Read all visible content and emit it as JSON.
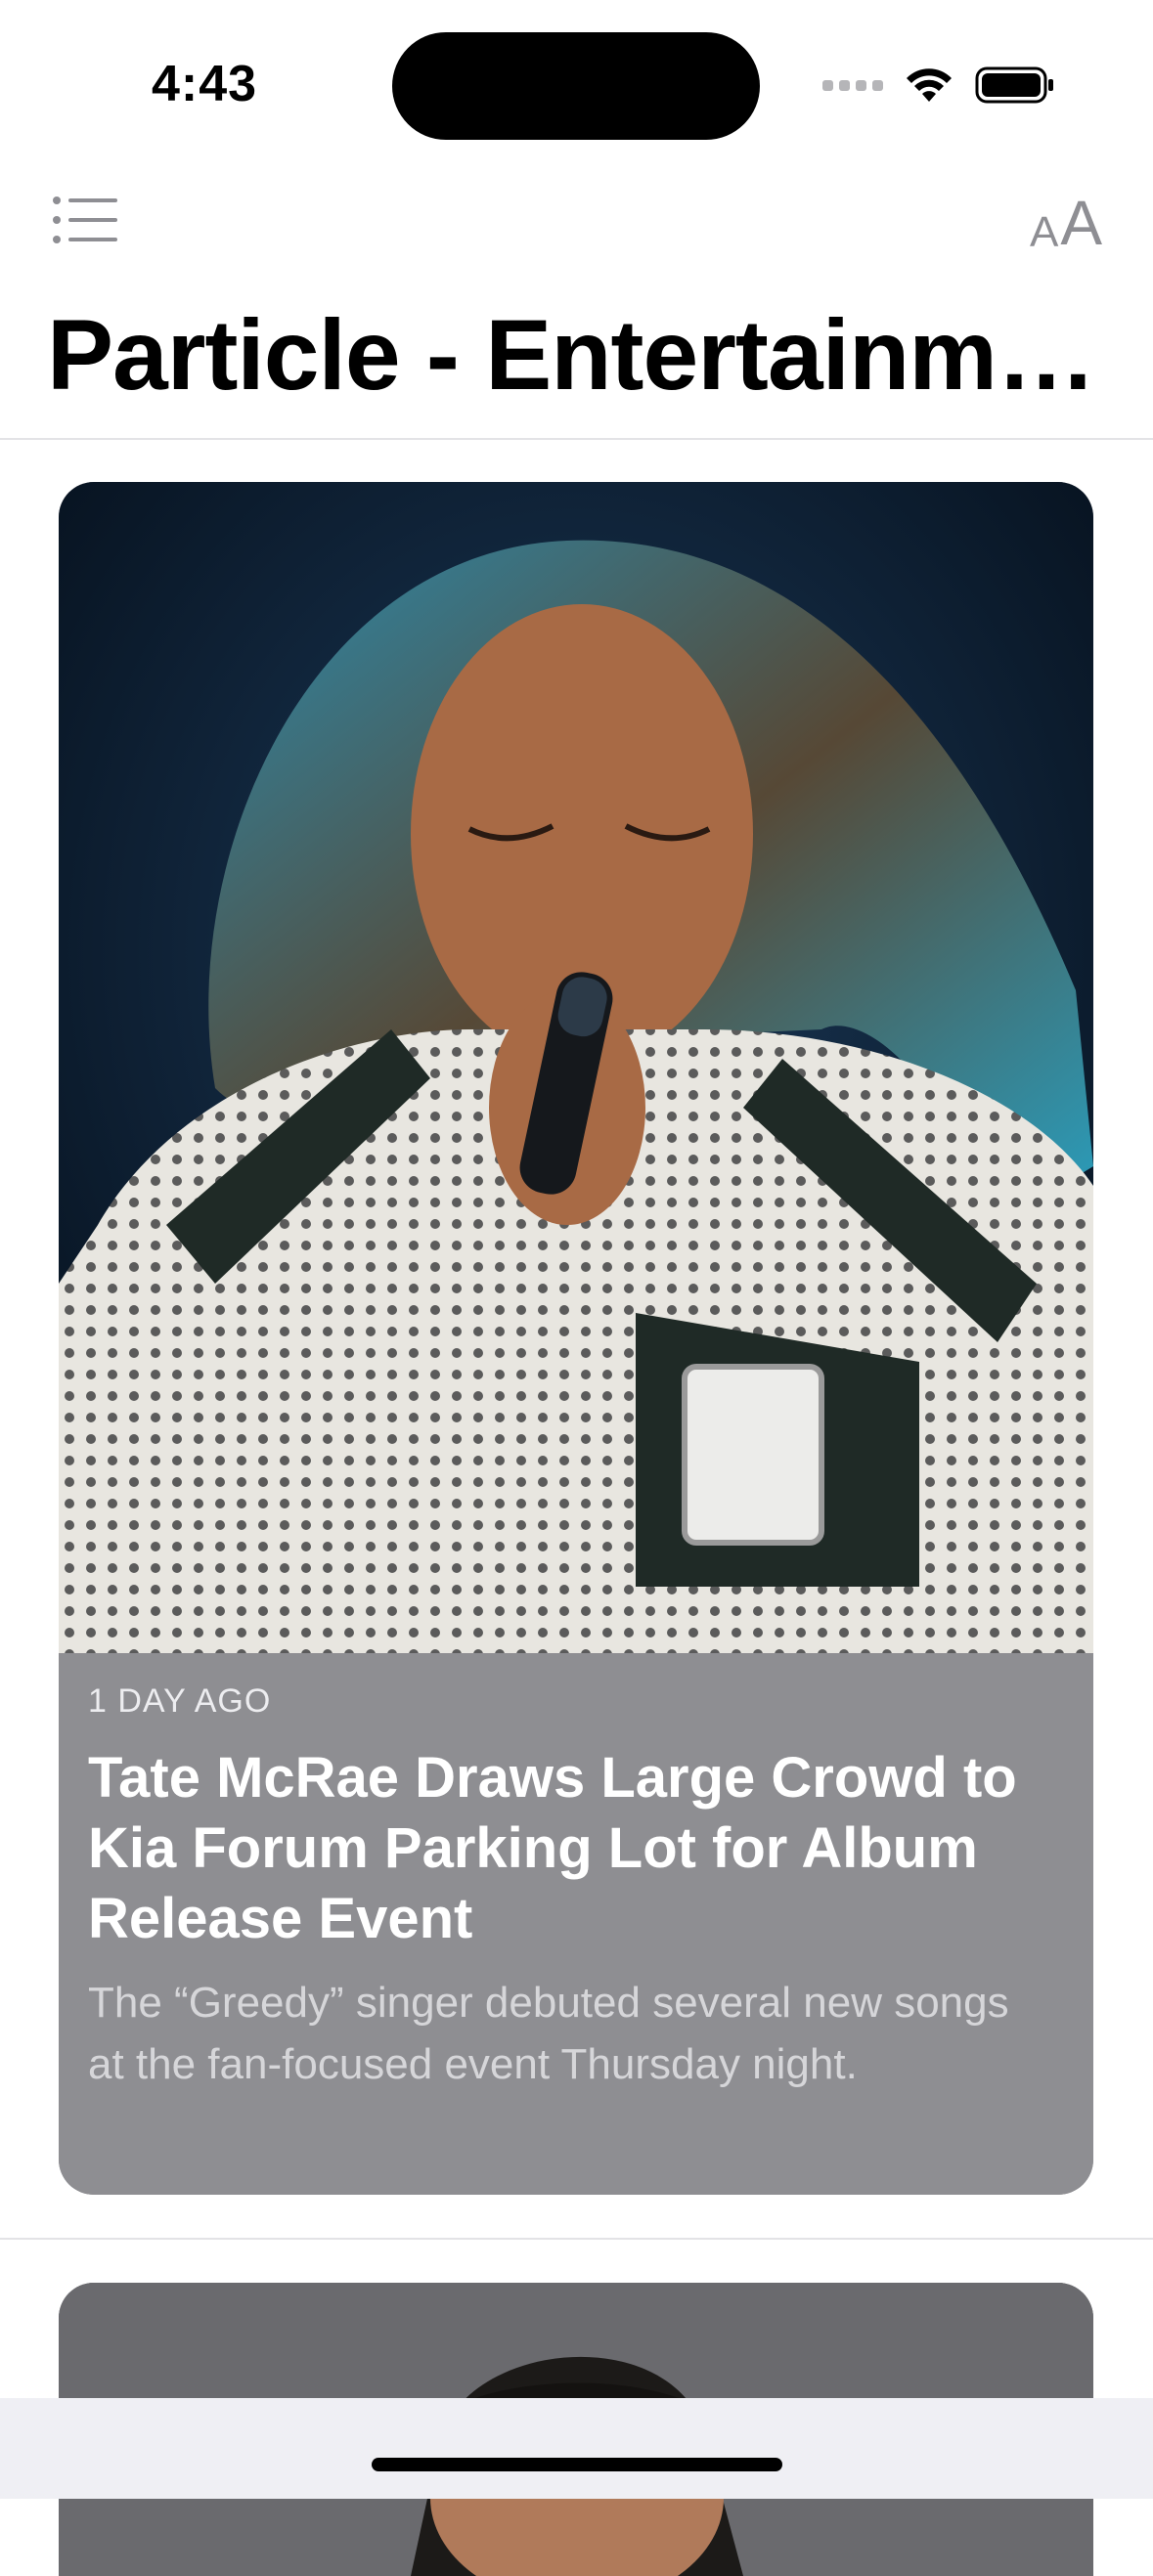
{
  "status_bar": {
    "time": "4:43"
  },
  "header": {
    "menu_icon": "list-icon",
    "text_size_icon": "text-size-icon",
    "text_size_small": "A",
    "text_size_large": "A",
    "title": "Particle - Entertainme..."
  },
  "articles": [
    {
      "age": "1 DAY AGO",
      "headline": "Tate McRae Draws Large Crowd to Kia Forum Parking Lot for Album Release Event",
      "summary": "The “Greedy” singer debuted several new songs at the fan-focused event Thursday night.",
      "image": "photo of singer performing with microphone"
    }
  ],
  "colors": {
    "card_background": "#8e8e92",
    "headline": "#ffffff",
    "summary": "#d6d6d9",
    "icon_gray": "#8e8e93"
  }
}
